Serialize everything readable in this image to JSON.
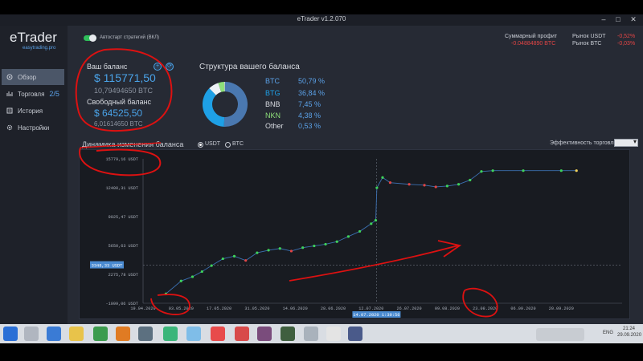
{
  "window": {
    "title": "eTrader v1.2.070",
    "minimize": "–",
    "maximize": "□",
    "close": "✕"
  },
  "logo": {
    "name": "eTrader",
    "site": "easytrading.pro"
  },
  "sidebar": {
    "items": [
      {
        "label": "Обзор",
        "icon": "overview-icon"
      },
      {
        "label": "Торговля",
        "badge": "2/5",
        "icon": "trade-icon"
      },
      {
        "label": "История",
        "icon": "history-icon"
      },
      {
        "label": "Настройки",
        "icon": "settings-icon"
      }
    ]
  },
  "autostart": {
    "label": "Автостарт стратегий (ВКЛ)",
    "on": true
  },
  "header": {
    "total_profit_label": "Суммарный профит",
    "total_profit_value": "-0.04884890 BTC",
    "market_usdt_label": "Рынок USDT",
    "market_usdt_value": "-0,52%",
    "market_btc_label": "Рынок BTC",
    "market_btc_value": "-0,03%"
  },
  "balance": {
    "title": "Ваш баланс",
    "usdt": "$ 115771,50",
    "btc": "10,79494650 BTC",
    "free_title": "Свободный баланс",
    "free_usdt": "$ 64525,50",
    "free_btc": "6,01614650 BTC"
  },
  "structure": {
    "title": "Структура вашего баланса",
    "items": [
      {
        "name": "BTC",
        "pct": "50,79 %",
        "value": 50.79,
        "color": "#4a78b0"
      },
      {
        "name": "BTG",
        "pct": "36,84 %",
        "value": 36.84,
        "color": "#1ea0e6"
      },
      {
        "name": "BNB",
        "pct": "7,45 %",
        "value": 7.45,
        "color": "#eef2f6"
      },
      {
        "name": "NKN",
        "pct": "4,38 %",
        "value": 4.38,
        "color": "#8ee07a"
      },
      {
        "name": "Other",
        "pct": "0,53 %",
        "value": 0.53,
        "color": "#cfd5dc"
      }
    ]
  },
  "dynamics": {
    "title": "Динамика изменения баланса",
    "opt_usdt": "USDT",
    "opt_btc": "BTC",
    "selected": "USDT",
    "efficiency_label": "Эффективность торговли к"
  },
  "chart_data": {
    "type": "line",
    "y_ticks": [
      "15779,16 USDT",
      "12400,31 USDT",
      "9025,47 USDT",
      "5650,63 USDT",
      "2275,78 USDT",
      "-1099,06 USDT"
    ],
    "y_values": [
      15779.16,
      12400.31,
      9025.47,
      5650.63,
      2275.78,
      -1099.06
    ],
    "ylim": [
      -1099.06,
      15779.16
    ],
    "x_ticks": [
      "19.04.2020",
      "03.05.2020",
      "17.05.2020",
      "31.05.2020",
      "14.06.2020",
      "28.06.2020",
      "12.07.2020",
      "26.07.2020",
      "09.08.2020",
      "23.08.2020",
      "06.09.2020",
      "20.09.2020"
    ],
    "crosshair_y_label": "3348,33 USDT",
    "crosshair_x_label": "14.07.2020 1:39:56",
    "crosshair_y_value": 3348.33,
    "crosshair_x_index": 6.14,
    "series": [
      {
        "values": [
          [
            0.6,
            0
          ],
          [
            1.0,
            1500
          ],
          [
            1.3,
            2000
          ],
          [
            1.55,
            2600
          ],
          [
            1.8,
            3300
          ],
          [
            2.1,
            4100
          ],
          [
            2.4,
            4400
          ],
          [
            2.7,
            3900
          ],
          [
            3.0,
            4800
          ],
          [
            3.3,
            5100
          ],
          [
            3.6,
            5300
          ],
          [
            3.9,
            5000
          ],
          [
            4.2,
            5400
          ],
          [
            4.5,
            5600
          ],
          [
            4.8,
            5800
          ],
          [
            5.1,
            6100
          ],
          [
            5.4,
            6700
          ],
          [
            5.7,
            7300
          ],
          [
            6.0,
            8200
          ],
          [
            6.12,
            8600
          ],
          [
            6.15,
            12400
          ],
          [
            6.3,
            13600
          ],
          [
            6.5,
            13000
          ],
          [
            7.0,
            12800
          ],
          [
            7.4,
            12700
          ],
          [
            7.7,
            12500
          ],
          [
            8.0,
            12600
          ],
          [
            8.3,
            12800
          ],
          [
            8.6,
            13300
          ],
          [
            8.9,
            14300
          ],
          [
            9.2,
            14400
          ],
          [
            10.0,
            14400
          ],
          [
            11.0,
            14400
          ],
          [
            11.4,
            14400
          ]
        ]
      }
    ]
  },
  "taskbar": {
    "lang": "ENG",
    "time": "21:24",
    "date": "29.09.2020"
  }
}
